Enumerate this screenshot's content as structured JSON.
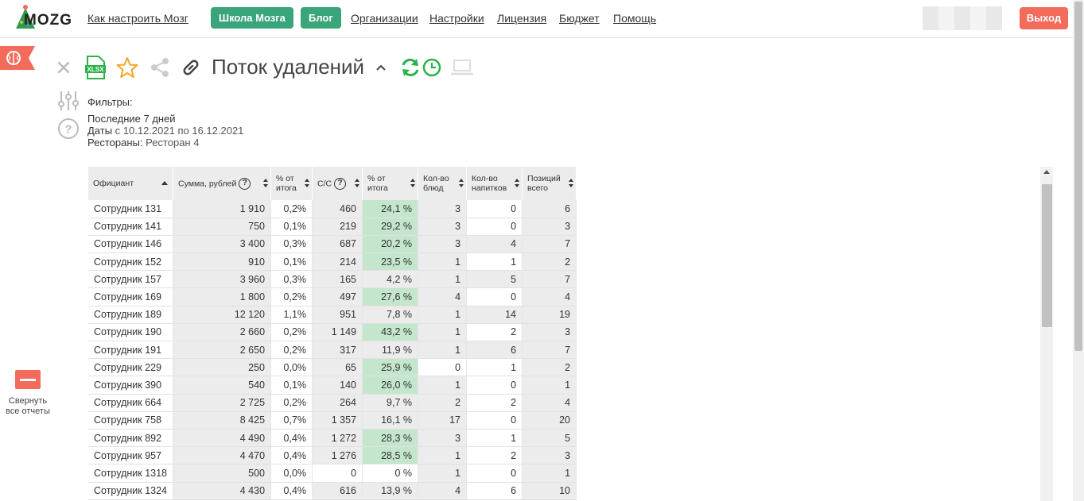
{
  "header": {
    "logo_text": "MOZG",
    "nav": {
      "how_to": "Как настроить Мозг",
      "school": "Школа Мозга",
      "blog": "Блог",
      "orgs": "Организации",
      "settings": "Настройки",
      "license": "Лицензия",
      "budget": "Бюджет",
      "help": "Помощь"
    },
    "logout": "Выход"
  },
  "sidebar": {
    "collapse_label": "Свернуть все отчеты"
  },
  "report": {
    "title": "Поток удалений",
    "filters_label": "Фильтры:",
    "period": "Последние 7 дней",
    "dates_label": "Даты",
    "dates_value": "с 10.12.2021 по 16.12.2021",
    "restaurants_label": "Рестораны:",
    "restaurants_value": "Ресторан 4"
  },
  "table": {
    "headers": {
      "waiter": "Официант",
      "sum": "Сумма, рублей",
      "pct1_a": "% от",
      "pct1_b": "итога",
      "cost": "С/С",
      "pct2_a": "% от",
      "pct2_b": "итога",
      "dishes_a": "Кол-во",
      "dishes_b": "блюд",
      "drinks_a": "Кол-во",
      "drinks_b": "напитков",
      "items_a": "Позиций",
      "items_b": "всего"
    },
    "rows": [
      [
        "Сотрудник 131",
        "1 910",
        "0,2%",
        "460",
        "24,1 %",
        "3",
        "0",
        "6"
      ],
      [
        "Сотрудник 141",
        "750",
        "0,1%",
        "219",
        "29,2 %",
        "3",
        "0",
        "3"
      ],
      [
        "Сотрудник 146",
        "3 400",
        "0,3%",
        "687",
        "20,2 %",
        "3",
        "4",
        "7"
      ],
      [
        "Сотрудник 152",
        "910",
        "0,1%",
        "214",
        "23,5 %",
        "1",
        "1",
        "2"
      ],
      [
        "Сотрудник 157",
        "3 960",
        "0,3%",
        "165",
        "4,2 %",
        "1",
        "5",
        "7"
      ],
      [
        "Сотрудник 169",
        "1 800",
        "0,2%",
        "497",
        "27,6 %",
        "4",
        "0",
        "4"
      ],
      [
        "Сотрудник 189",
        "12 120",
        "1,1%",
        "951",
        "7,8 %",
        "1",
        "14",
        "19"
      ],
      [
        "Сотрудник 190",
        "2 660",
        "0,2%",
        "1 149",
        "43,2 %",
        "1",
        "2",
        "3"
      ],
      [
        "Сотрудник 191",
        "2 650",
        "0,2%",
        "317",
        "11,9 %",
        "1",
        "6",
        "7"
      ],
      [
        "Сотрудник 229",
        "250",
        "0,0%",
        "65",
        "25,9 %",
        "0",
        "1",
        "2"
      ],
      [
        "Сотрудник 390",
        "540",
        "0,1%",
        "140",
        "26,0 %",
        "1",
        "0",
        "1"
      ],
      [
        "Сотрудник 664",
        "2 725",
        "0,2%",
        "264",
        "9,7 %",
        "2",
        "2",
        "4"
      ],
      [
        "Сотрудник 758",
        "8 425",
        "0,7%",
        "1 357",
        "16,1 %",
        "17",
        "0",
        "20"
      ],
      [
        "Сотрудник 892",
        "4 490",
        "0,4%",
        "1 272",
        "28,3 %",
        "3",
        "1",
        "5"
      ],
      [
        "Сотрудник 957",
        "4 470",
        "0,4%",
        "1 276",
        "28,5 %",
        "1",
        "2",
        "3"
      ],
      [
        "Сотрудник 1318",
        "500",
        "0,0%",
        "0",
        "0 %",
        "1",
        "0",
        "1"
      ],
      [
        "Сотрудник 1324",
        "4 430",
        "0,4%",
        "616",
        "13,9 %",
        "4",
        "6",
        "10"
      ]
    ],
    "shading": [
      [
        "grey",
        "white",
        "grey",
        "green",
        "grey",
        "white",
        "grey"
      ],
      [
        "grey",
        "white",
        "grey",
        "green",
        "grey",
        "white",
        "grey"
      ],
      [
        "grey",
        "white",
        "grey",
        "green",
        "grey",
        "grey",
        "grey"
      ],
      [
        "grey",
        "white",
        "grey",
        "green",
        "grey",
        "white",
        "grey"
      ],
      [
        "grey",
        "white",
        "grey",
        "grey",
        "grey",
        "grey",
        "grey"
      ],
      [
        "grey",
        "white",
        "grey",
        "green",
        "grey",
        "white",
        "grey"
      ],
      [
        "grey",
        "white",
        "grey",
        "grey",
        "grey",
        "grey",
        "grey"
      ],
      [
        "grey",
        "white",
        "grey",
        "green",
        "grey",
        "white",
        "grey"
      ],
      [
        "grey",
        "white",
        "grey",
        "grey",
        "grey",
        "grey",
        "grey"
      ],
      [
        "grey",
        "white",
        "grey",
        "green",
        "white",
        "white",
        "grey"
      ],
      [
        "grey",
        "white",
        "grey",
        "green",
        "grey",
        "white",
        "grey"
      ],
      [
        "grey",
        "white",
        "grey",
        "grey",
        "grey",
        "white",
        "grey"
      ],
      [
        "grey",
        "white",
        "grey",
        "grey",
        "grey",
        "white",
        "grey"
      ],
      [
        "grey",
        "white",
        "grey",
        "green",
        "grey",
        "white",
        "grey"
      ],
      [
        "grey",
        "white",
        "grey",
        "green",
        "grey",
        "white",
        "grey"
      ],
      [
        "grey",
        "white",
        "white",
        "white",
        "grey",
        "white",
        "grey"
      ],
      [
        "grey",
        "white",
        "grey",
        "grey",
        "grey",
        "white",
        "grey"
      ]
    ]
  },
  "colors": {
    "brand_green": "#3aa57a",
    "logout_red": "#f26b5b",
    "cell_grey": "#ececec",
    "cell_green": "#c4e6cc",
    "refresh_green": "#2bb34a"
  },
  "icons": [
    "close-icon",
    "xlsx-icon",
    "star-icon",
    "share-icon",
    "link-icon",
    "caret-up-icon",
    "refresh-icon",
    "clock-icon",
    "laptop-icon",
    "filters-icon",
    "help-icon",
    "brain-icon"
  ]
}
